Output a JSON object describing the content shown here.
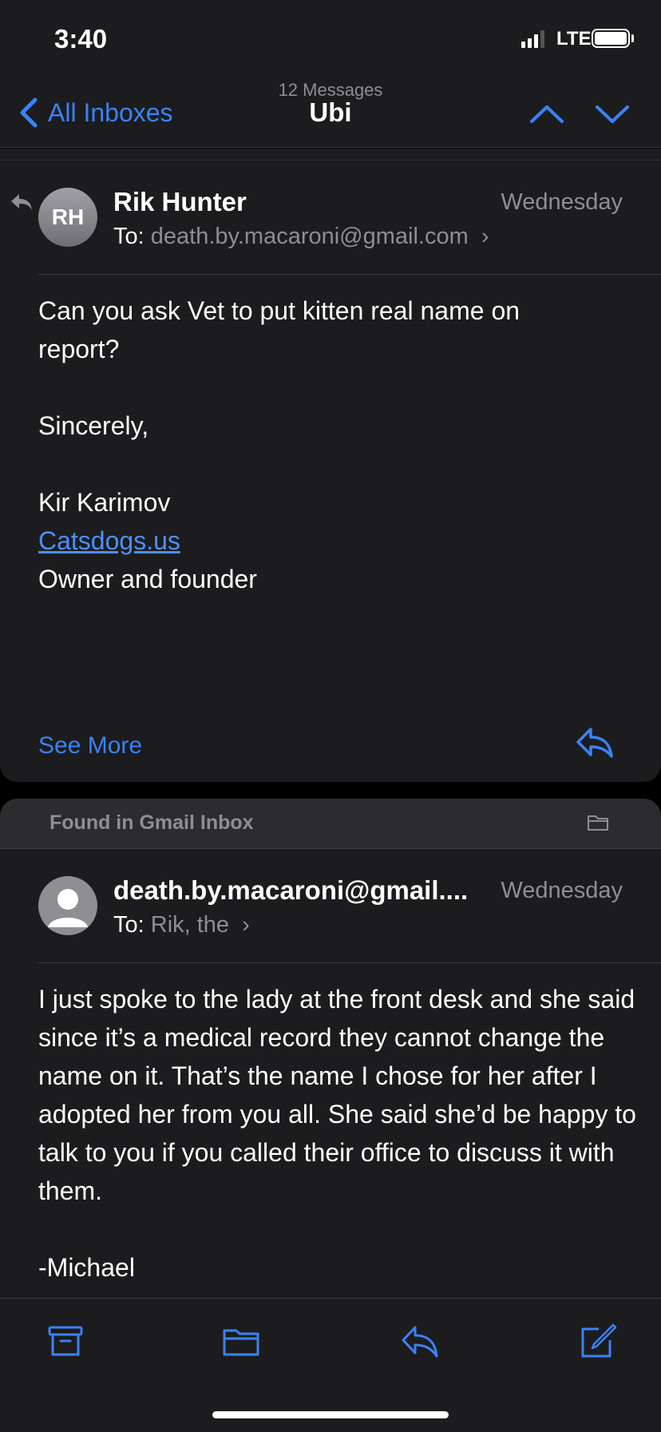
{
  "status_bar": {
    "time": "3:40",
    "network": "LTE"
  },
  "nav": {
    "back_label": "All Inboxes",
    "message_count": "12 Messages",
    "title": "Ubi"
  },
  "messages": [
    {
      "avatar_initials": "RH",
      "sender": "Rik Hunter",
      "date": "Wednesday",
      "to_label": "To:",
      "to_value": "death.by.macaroni@gmail.com",
      "body": {
        "line1": "Can you ask Vet to put kitten real name on report?",
        "closing": "Sincerely,",
        "name": "Kir Karimov",
        "link": "Catsdogs.us",
        "role": "Owner and founder"
      },
      "see_more": "See More"
    },
    {
      "found_in": "Found in Gmail Inbox",
      "sender": "death.by.macaroni@gmail....",
      "date": "Wednesday",
      "to_label": "To:",
      "to_value": "Rik, the",
      "body": {
        "text": "I just spoke to the lady at the front desk and she said since it’s a medical record they cannot change the name on it. That’s the name I chose for her after I adopted her from you all. She said she’d be happy to talk to you if you called their office to discuss it with them.",
        "signature": "-Michael"
      }
    }
  ],
  "toolbar": [
    "archive-icon",
    "folder-icon",
    "reply-icon",
    "compose-icon"
  ],
  "colors": {
    "accent": "#3b82f6",
    "background": "#1c1c1e",
    "secondary_text": "#8e8e93"
  }
}
